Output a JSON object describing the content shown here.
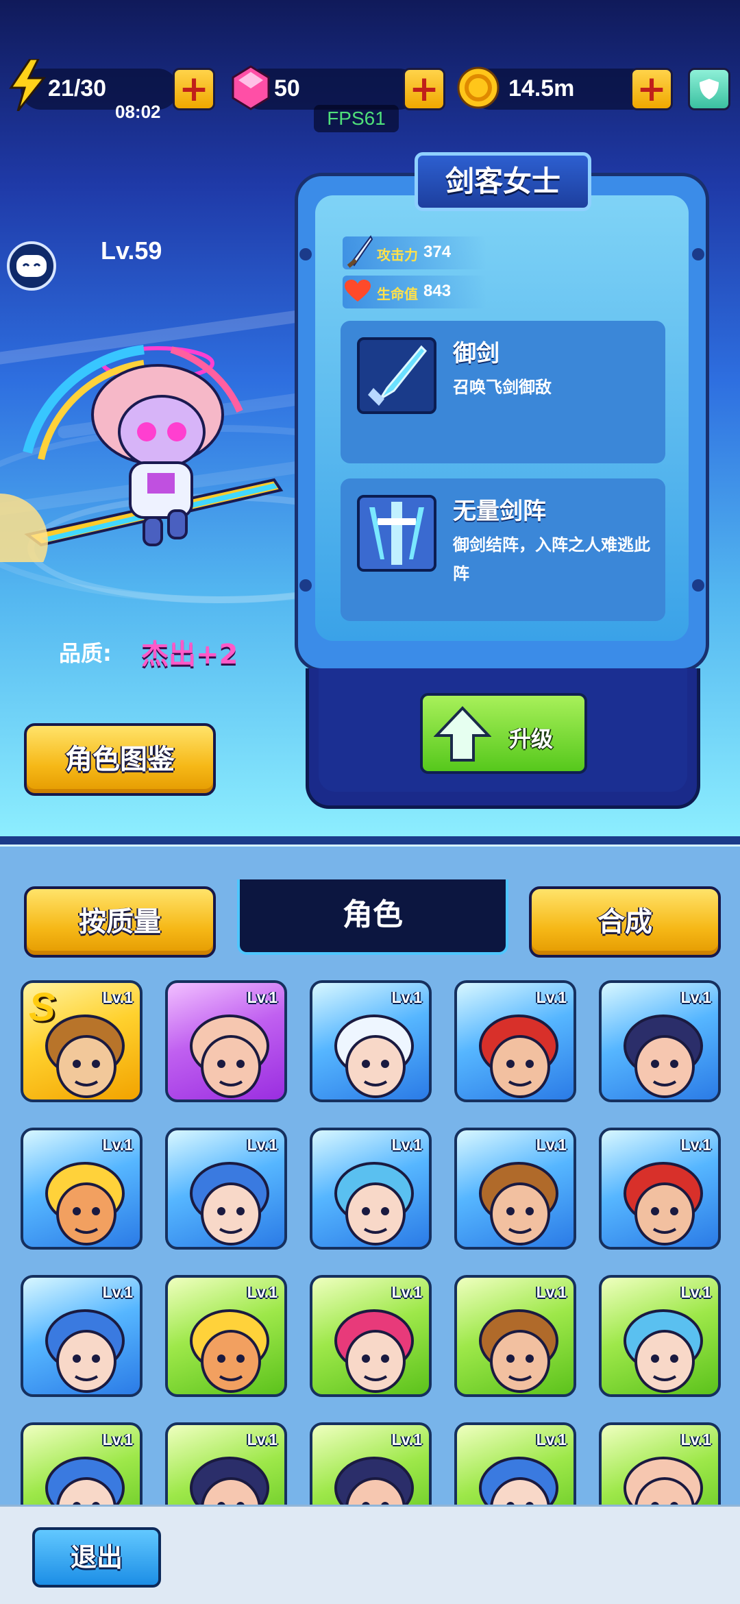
{
  "resources": {
    "energy": "21/30",
    "energy_timer": "08:02",
    "gems": "50",
    "coins": "14.5m",
    "fps": "FPS61"
  },
  "hero": {
    "level": "Lv.59",
    "name": "剑客女士",
    "quality_label": "品质:",
    "quality_value": "杰出+2",
    "attack_label": "攻击力",
    "attack_value": "374",
    "hp_label": "生命值",
    "hp_value": "843"
  },
  "skills": [
    {
      "name": "御剑",
      "desc": "召唤飞剑御敌"
    },
    {
      "name": "无量剑阵",
      "desc": "御剑结阵，入阵之人难逃此阵"
    }
  ],
  "buttons": {
    "upgrade": "升级",
    "codex": "角色图鉴",
    "sort": "按质量",
    "merge": "合成",
    "exit": "退出"
  },
  "tabs": {
    "characters": "角色"
  },
  "roster": {
    "rank_badge": "S",
    "cards": [
      {
        "level": "Lv.1",
        "rarity": "gold",
        "face": "lion-man"
      },
      {
        "level": "Lv.1",
        "rarity": "purple",
        "face": "bald-guy"
      },
      {
        "level": "Lv.1",
        "rarity": "blue",
        "face": "white-hair-girl"
      },
      {
        "level": "Lv.1",
        "rarity": "blue",
        "face": "black-beard-pirate"
      },
      {
        "level": "Lv.1",
        "rarity": "blue",
        "face": "monocle-man"
      },
      {
        "level": "Lv.1",
        "rarity": "blue",
        "face": "blonde-viking"
      },
      {
        "level": "Lv.1",
        "rarity": "blue",
        "face": "blue-hair-girl"
      },
      {
        "level": "Lv.1",
        "rarity": "blue",
        "face": "blue-monster"
      },
      {
        "level": "Lv.1",
        "rarity": "blue",
        "face": "cowboy"
      },
      {
        "level": "Lv.1",
        "rarity": "blue",
        "face": "black-beard-pirate"
      },
      {
        "level": "Lv.1",
        "rarity": "blue",
        "face": "blue-hair-girl"
      },
      {
        "level": "Lv.1",
        "rarity": "green",
        "face": "blonde-viking"
      },
      {
        "level": "Lv.1",
        "rarity": "green",
        "face": "pink-hair-girl"
      },
      {
        "level": "Lv.1",
        "rarity": "green",
        "face": "cowboy"
      },
      {
        "level": "Lv.1",
        "rarity": "green",
        "face": "blue-monster"
      },
      {
        "level": "Lv.1",
        "rarity": "green",
        "face": "blue-hair-girl"
      },
      {
        "level": "Lv.1",
        "rarity": "green",
        "face": "monocle-man"
      },
      {
        "level": "Lv.1",
        "rarity": "green",
        "face": "monocle-man"
      },
      {
        "level": "Lv.1",
        "rarity": "green",
        "face": "blue-hair-girl"
      },
      {
        "level": "Lv.1",
        "rarity": "green",
        "face": "bald-guy"
      }
    ]
  },
  "colors": {
    "gold": "#ffd12e",
    "green": "#9ee84a",
    "blue": "#56b6ff",
    "purple": "#c060f0",
    "quality": "#ff59c8"
  }
}
